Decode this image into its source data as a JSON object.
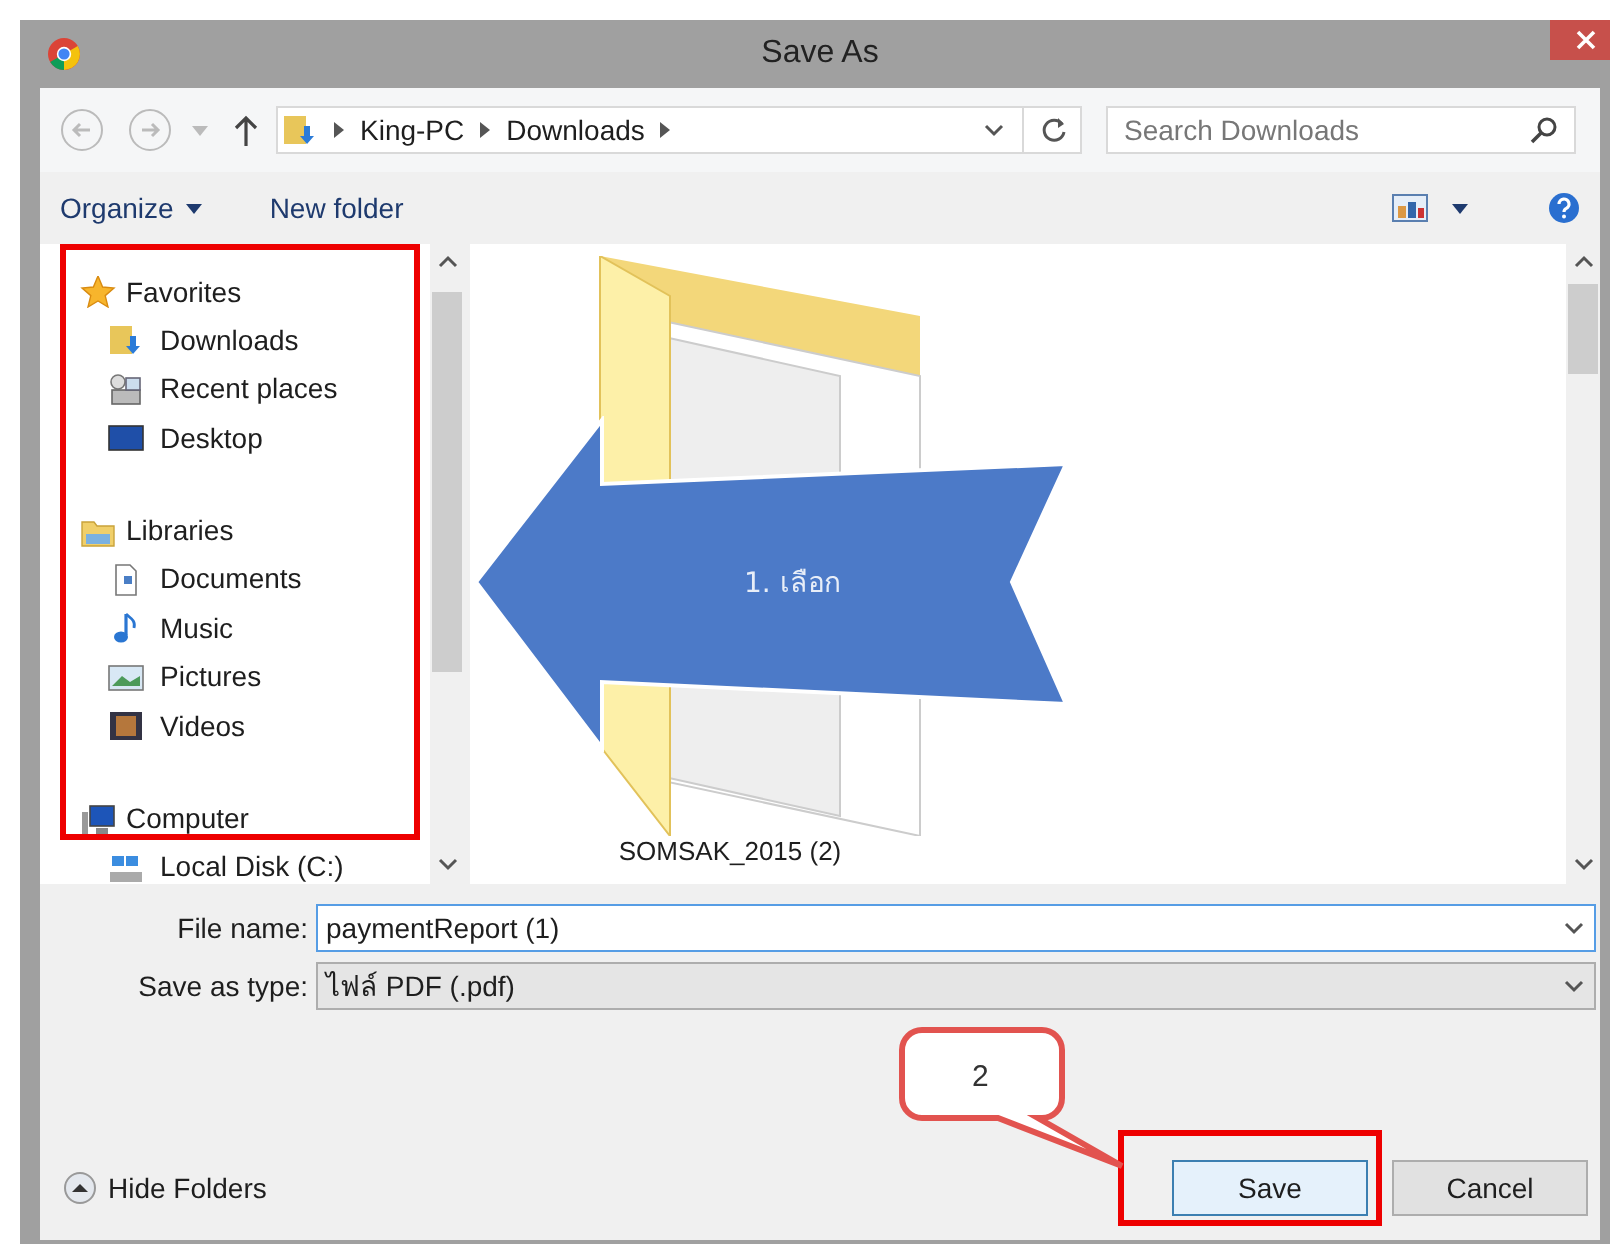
{
  "window": {
    "title": "Save As"
  },
  "nav": {
    "path": [
      "King-PC",
      "Downloads"
    ],
    "search": {
      "placeholder": "Search Downloads"
    }
  },
  "toolbar": {
    "organize": "Organize",
    "new_folder": "New folder"
  },
  "sidebar": {
    "items": [
      {
        "label": "Favorites",
        "kind": "star",
        "children": [
          {
            "label": "Downloads",
            "kind": "downloads"
          },
          {
            "label": "Recent places",
            "kind": "recent"
          },
          {
            "label": "Desktop",
            "kind": "desktop"
          }
        ]
      },
      {
        "label": "Libraries",
        "kind": "library",
        "children": [
          {
            "label": "Documents",
            "kind": "documents"
          },
          {
            "label": "Music",
            "kind": "music"
          },
          {
            "label": "Pictures",
            "kind": "pictures"
          },
          {
            "label": "Videos",
            "kind": "videos"
          }
        ]
      },
      {
        "label": "Computer",
        "kind": "computer",
        "children": [
          {
            "label": "Local Disk (C:)",
            "kind": "disk"
          }
        ]
      }
    ]
  },
  "files": [
    {
      "name": "SOMSAK_2015 (2)"
    }
  ],
  "form": {
    "file_name_label": "File name:",
    "file_name": "paymentReport (1)",
    "type_label": "Save as type:",
    "type": "ไฟล์ PDF (.pdf)"
  },
  "footer": {
    "hide_folders": "Hide Folders",
    "buttons": [
      "Save",
      "Cancel"
    ]
  },
  "annotations": [
    {
      "kind": "arrow",
      "label": "1. เลือก"
    },
    {
      "kind": "callout",
      "label": "2"
    }
  ]
}
